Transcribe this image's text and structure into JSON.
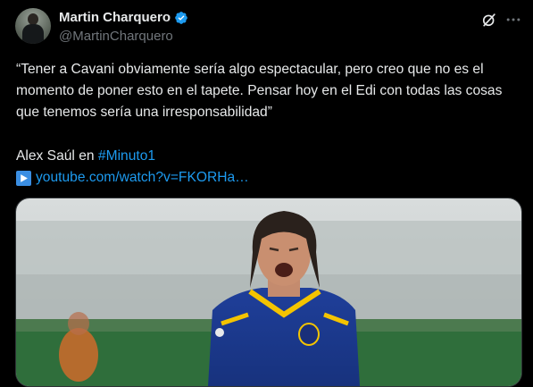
{
  "author": {
    "name": "Martin Charquero",
    "handle": "@MartinCharquero",
    "verified": true
  },
  "tweet": {
    "text": "“Tener a Cavani obviamente sería algo espectacular, pero creo que no es el momento de poner esto en el tapete. Pensar hoy en el Edi con todas las cosas que tenemos sería una irresponsabilidad”",
    "byline_prefix": "Alex Saúl en",
    "hashtag": "#Minuto1",
    "link": "youtube.com/watch?v=FKORHa…"
  },
  "media": {
    "description_icon": "photo",
    "kit_badge": "CABJ"
  },
  "icons": {
    "grok": "grok-icon",
    "more": "more-icon",
    "play": "play-icon"
  },
  "colors": {
    "background": "#000000",
    "text": "#e7e9ea",
    "muted": "#71767b",
    "link": "#1d9bf0",
    "verified": "#1d9bf0"
  }
}
